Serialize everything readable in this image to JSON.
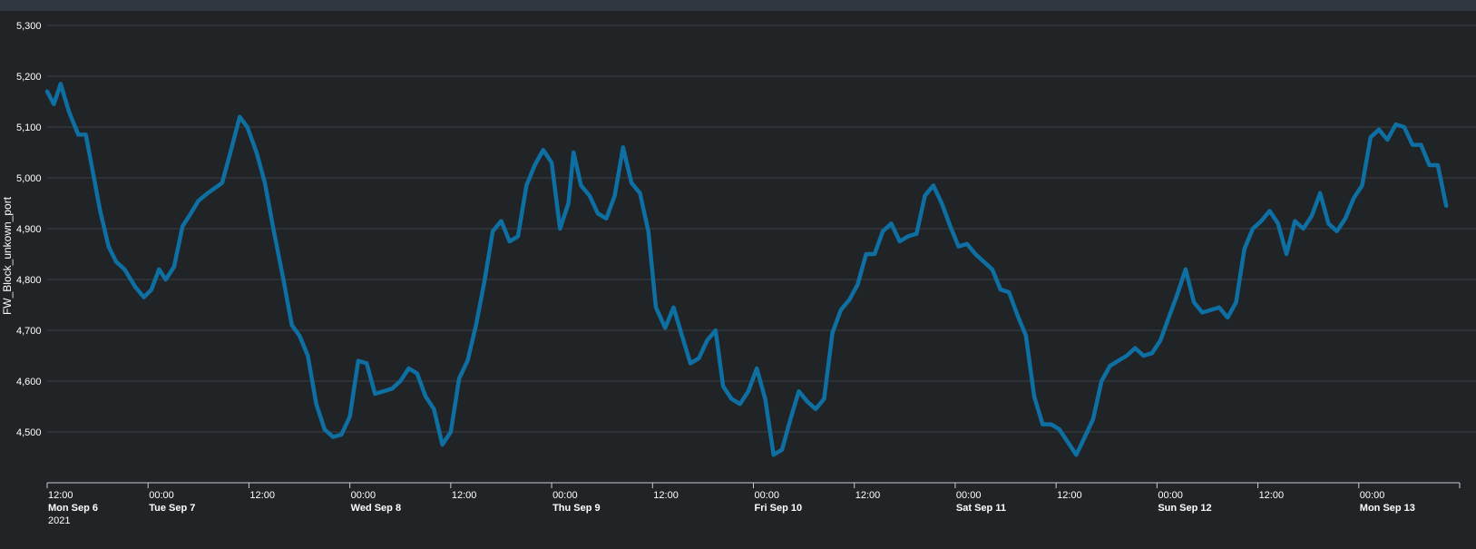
{
  "chart_data": {
    "type": "line",
    "title": "",
    "ylabel": "FW_Block_unkown_port",
    "xlabel": "",
    "ylim": [
      4400,
      5300
    ],
    "yticks": [
      4500,
      4600,
      4700,
      4800,
      4900,
      5000,
      5100,
      5200,
      5300
    ],
    "ytick_labels": [
      "4,500",
      "4,600",
      "4,700",
      "4,800",
      "4,900",
      "5,000",
      "5,100",
      "5,200",
      "5,300"
    ],
    "xlim_hours": [
      0,
      168
    ],
    "xticks": [
      {
        "hour": 0,
        "time": "12:00",
        "date": "Mon Sep 6",
        "year": "2021"
      },
      {
        "hour": 12,
        "time": "00:00",
        "date": "Tue Sep 7"
      },
      {
        "hour": 24,
        "time": "12:00"
      },
      {
        "hour": 36,
        "time": "00:00",
        "date": "Wed Sep 8"
      },
      {
        "hour": 48,
        "time": "12:00"
      },
      {
        "hour": 60,
        "time": "00:00",
        "date": "Thu Sep 9"
      },
      {
        "hour": 72,
        "time": "12:00"
      },
      {
        "hour": 84,
        "time": "00:00",
        "date": "Fri Sep 10"
      },
      {
        "hour": 96,
        "time": "12:00"
      },
      {
        "hour": 108,
        "time": "00:00",
        "date": "Sat Sep 11"
      },
      {
        "hour": 120,
        "time": "12:00"
      },
      {
        "hour": 132,
        "time": "00:00",
        "date": "Sun Sep 12"
      },
      {
        "hour": 144,
        "time": "12:00"
      },
      {
        "hour": 156,
        "time": "00:00",
        "date": "Mon Sep 13"
      }
    ],
    "grid": true,
    "series": [
      {
        "color": "#0e6fa3",
        "points": [
          [
            0,
            5170
          ],
          [
            0.8,
            5145
          ],
          [
            1.6,
            5185
          ],
          [
            2.6,
            5130
          ],
          [
            3.7,
            5085
          ],
          [
            4.6,
            5085
          ],
          [
            5.4,
            5015
          ],
          [
            6.3,
            4935
          ],
          [
            7.3,
            4865
          ],
          [
            8.2,
            4835
          ],
          [
            9.2,
            4820
          ],
          [
            10.5,
            4785
          ],
          [
            11.5,
            4765
          ],
          [
            12.4,
            4780
          ],
          [
            13.3,
            4820
          ],
          [
            14.1,
            4800
          ],
          [
            15.1,
            4825
          ],
          [
            16.1,
            4905
          ],
          [
            16.9,
            4925
          ],
          [
            18.0,
            4955
          ],
          [
            19.1,
            4970
          ],
          [
            20.8,
            4990
          ],
          [
            21.8,
            5050
          ],
          [
            22.9,
            5120
          ],
          [
            23.8,
            5100
          ],
          [
            24.9,
            5050
          ],
          [
            25.9,
            4990
          ],
          [
            26.9,
            4900
          ],
          [
            28.1,
            4800
          ],
          [
            29.1,
            4710
          ],
          [
            30.0,
            4690
          ],
          [
            31.0,
            4650
          ],
          [
            32.0,
            4555
          ],
          [
            33.0,
            4505
          ],
          [
            34.0,
            4490
          ],
          [
            35.0,
            4495
          ],
          [
            36.0,
            4530
          ],
          [
            37.0,
            4640
          ],
          [
            38.0,
            4635
          ],
          [
            39.0,
            4575
          ],
          [
            40.0,
            4580
          ],
          [
            41.0,
            4585
          ],
          [
            42.0,
            4600
          ],
          [
            43.0,
            4625
          ],
          [
            44.0,
            4615
          ],
          [
            45.0,
            4570
          ],
          [
            46.0,
            4545
          ],
          [
            47.0,
            4475
          ],
          [
            48.0,
            4500
          ],
          [
            49.0,
            4605
          ],
          [
            50.0,
            4640
          ],
          [
            51.0,
            4710
          ],
          [
            52.0,
            4795
          ],
          [
            53.0,
            4895
          ],
          [
            54.0,
            4915
          ],
          [
            55.0,
            4875
          ],
          [
            56.0,
            4885
          ],
          [
            57.0,
            4985
          ],
          [
            58.0,
            5025
          ],
          [
            59.0,
            5055
          ],
          [
            60.0,
            5030
          ],
          [
            61.0,
            4900
          ],
          [
            62.0,
            4950
          ],
          [
            62.6,
            5050
          ],
          [
            63.5,
            4985
          ],
          [
            64.5,
            4965
          ],
          [
            65.5,
            4930
          ],
          [
            66.5,
            4920
          ],
          [
            67.5,
            4965
          ],
          [
            68.5,
            5060
          ],
          [
            69.5,
            4990
          ],
          [
            70.5,
            4970
          ],
          [
            71.5,
            4895
          ],
          [
            72.4,
            4745
          ],
          [
            73.5,
            4705
          ],
          [
            74.5,
            4745
          ],
          [
            75.5,
            4690
          ],
          [
            76.5,
            4635
          ],
          [
            77.5,
            4645
          ],
          [
            78.5,
            4680
          ],
          [
            79.5,
            4700
          ],
          [
            80.4,
            4590
          ],
          [
            81.4,
            4565
          ],
          [
            82.4,
            4555
          ],
          [
            83.4,
            4580
          ],
          [
            84.4,
            4625
          ],
          [
            85.4,
            4565
          ],
          [
            86.4,
            4455
          ],
          [
            87.4,
            4465
          ],
          [
            88.4,
            4525
          ],
          [
            89.4,
            4580
          ],
          [
            90.4,
            4560
          ],
          [
            91.4,
            4545
          ],
          [
            92.4,
            4565
          ],
          [
            93.4,
            4695
          ],
          [
            94.4,
            4740
          ],
          [
            95.4,
            4760
          ],
          [
            96.4,
            4790
          ],
          [
            97.4,
            4850
          ],
          [
            98.4,
            4850
          ],
          [
            99.4,
            4895
          ],
          [
            100.4,
            4910
          ],
          [
            101.4,
            4875
          ],
          [
            102.4,
            4885
          ],
          [
            103.4,
            4890
          ],
          [
            104.4,
            4965
          ],
          [
            105.4,
            4985
          ],
          [
            106.4,
            4950
          ],
          [
            107.4,
            4905
          ],
          [
            108.4,
            4865
          ],
          [
            109.4,
            4870
          ],
          [
            110.4,
            4850
          ],
          [
            111.4,
            4835
          ],
          [
            112.4,
            4820
          ],
          [
            113.4,
            4780
          ],
          [
            114.4,
            4775
          ],
          [
            115.4,
            4730
          ],
          [
            116.4,
            4690
          ],
          [
            117.4,
            4570
          ],
          [
            118.4,
            4515
          ],
          [
            119.4,
            4515
          ],
          [
            120.4,
            4505
          ],
          [
            121.4,
            4480
          ],
          [
            122.4,
            4455
          ],
          [
            123.4,
            4490
          ],
          [
            124.4,
            4525
          ],
          [
            125.4,
            4600
          ],
          [
            126.4,
            4630
          ],
          [
            127.4,
            4640
          ],
          [
            128.4,
            4650
          ],
          [
            129.4,
            4665
          ],
          [
            130.4,
            4650
          ],
          [
            131.4,
            4655
          ],
          [
            132.4,
            4680
          ],
          [
            133.4,
            4725
          ],
          [
            134.4,
            4770
          ],
          [
            135.4,
            4820
          ],
          [
            136.4,
            4755
          ],
          [
            137.4,
            4735
          ],
          [
            138.4,
            4740
          ],
          [
            139.4,
            4745
          ],
          [
            140.4,
            4725
          ],
          [
            141.4,
            4755
          ],
          [
            142.4,
            4860
          ],
          [
            143.4,
            4900
          ],
          [
            144.4,
            4915
          ],
          [
            145.4,
            4935
          ],
          [
            146.4,
            4910
          ],
          [
            147.4,
            4850
          ],
          [
            148.4,
            4915
          ],
          [
            149.4,
            4900
          ],
          [
            150.4,
            4925
          ],
          [
            151.4,
            4970
          ],
          [
            152.4,
            4910
          ],
          [
            153.4,
            4895
          ],
          [
            154.4,
            4920
          ],
          [
            155.4,
            4960
          ],
          [
            156.4,
            4985
          ],
          [
            157.4,
            5080
          ],
          [
            158.4,
            5095
          ],
          [
            159.4,
            5075
          ],
          [
            160.4,
            5105
          ],
          [
            161.4,
            5100
          ],
          [
            162.4,
            5065
          ],
          [
            163.4,
            5065
          ],
          [
            164.4,
            5025
          ],
          [
            165.4,
            5025
          ],
          [
            166.4,
            4945
          ]
        ]
      }
    ]
  }
}
